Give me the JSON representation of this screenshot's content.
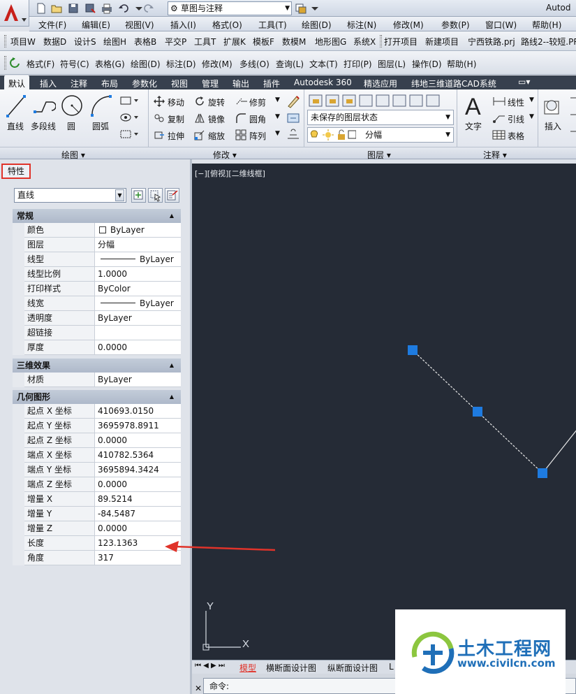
{
  "app": {
    "title_partial": "Autod"
  },
  "workspace": {
    "label": "草图与注释"
  },
  "menubar": {
    "items": [
      "文件(F)",
      "编辑(E)",
      "视图(V)",
      "插入(I)",
      "格式(O)",
      "工具(T)",
      "绘图(D)",
      "标注(N)",
      "修改(M)",
      "参数(P)",
      "窗口(W)",
      "帮助(H)"
    ]
  },
  "toolbar2": {
    "items": [
      "项目W",
      "数据D",
      "设计S",
      "绘图H",
      "表格B",
      "平交P",
      "工具T",
      "扩展K",
      "模板F",
      "数模M",
      "地形图G",
      "系统X",
      "打开项目",
      "新建项目",
      "宁西铁路.prj",
      "路线2--较短.PR"
    ]
  },
  "toolbar3": {
    "items": [
      "格式(F)",
      "符号(C)",
      "表格(G)",
      "绘图(D)",
      "标注(D)",
      "修改(M)",
      "多线(O)",
      "查询(L)",
      "文本(T)",
      "打印(P)",
      "图层(L)",
      "操作(D)",
      "帮助(H)"
    ]
  },
  "ribbon": {
    "tabs": [
      "默认",
      "插入",
      "注释",
      "布局",
      "参数化",
      "视图",
      "管理",
      "输出",
      "插件",
      "Autodesk 360",
      "精选应用",
      "纬地三维道路CAD系统"
    ],
    "draw": {
      "line": "直线",
      "polyline": "多段线",
      "circle": "圆",
      "arc": "圆弧",
      "panel": "绘图"
    },
    "modify": {
      "move": "移动",
      "rotate": "旋转",
      "trim": "修剪",
      "copy": "复制",
      "mirror": "镜像",
      "fillet": "圆角",
      "stretch": "拉伸",
      "scale": "缩放",
      "array": "阵列",
      "panel": "修改"
    },
    "layers": {
      "state": "未保存的图层状态",
      "current": "分幅",
      "panel": "图层"
    },
    "annotation": {
      "text": "文字",
      "dim": "线性",
      "leader": "引线",
      "table": "表格",
      "panel": "注释"
    },
    "insert": {
      "label": "插入"
    }
  },
  "properties": {
    "tab": "特性",
    "object_type": "直线",
    "sections": {
      "general": "常规",
      "effects3d": "三维效果",
      "geometry": "几何图形"
    },
    "general": [
      {
        "k": "颜色",
        "v": "ByLayer"
      },
      {
        "k": "图层",
        "v": "分幅"
      },
      {
        "k": "线型",
        "v": "ByLayer"
      },
      {
        "k": "线型比例",
        "v": "1.0000"
      },
      {
        "k": "打印样式",
        "v": "ByColor"
      },
      {
        "k": "线宽",
        "v": "ByLayer"
      },
      {
        "k": "透明度",
        "v": "ByLayer"
      },
      {
        "k": "超链接",
        "v": ""
      },
      {
        "k": "厚度",
        "v": "0.0000"
      }
    ],
    "effects3d": [
      {
        "k": "材质",
        "v": "ByLayer"
      }
    ],
    "geometry": [
      {
        "k": "起点 X 坐标",
        "v": "410693.0150"
      },
      {
        "k": "起点 Y 坐标",
        "v": "3695978.8911"
      },
      {
        "k": "起点 Z 坐标",
        "v": "0.0000"
      },
      {
        "k": "端点 X 坐标",
        "v": "410782.5364"
      },
      {
        "k": "端点 Y 坐标",
        "v": "3695894.3424"
      },
      {
        "k": "端点 Z 坐标",
        "v": "0.0000"
      },
      {
        "k": "增量 X",
        "v": "89.5214"
      },
      {
        "k": "增量 Y",
        "v": "-84.5487"
      },
      {
        "k": "增量 Z",
        "v": "0.0000"
      },
      {
        "k": "长度",
        "v": "123.1363"
      },
      {
        "k": "角度",
        "v": "317"
      }
    ]
  },
  "viewport": {
    "label": "[−][俯视][二维线框]",
    "ucs_x": "X",
    "ucs_y": "Y"
  },
  "layout_tabs": [
    "模型",
    "横断面设计图",
    "纵断面设计图",
    "L"
  ],
  "command": {
    "prompt": "命令:"
  },
  "watermark": {
    "title": "土木工程网",
    "url": "www.civilcn.com"
  },
  "colors": {
    "highlight": "#e0332a",
    "grip": "#1e7be0",
    "canvas": "#252b36"
  }
}
